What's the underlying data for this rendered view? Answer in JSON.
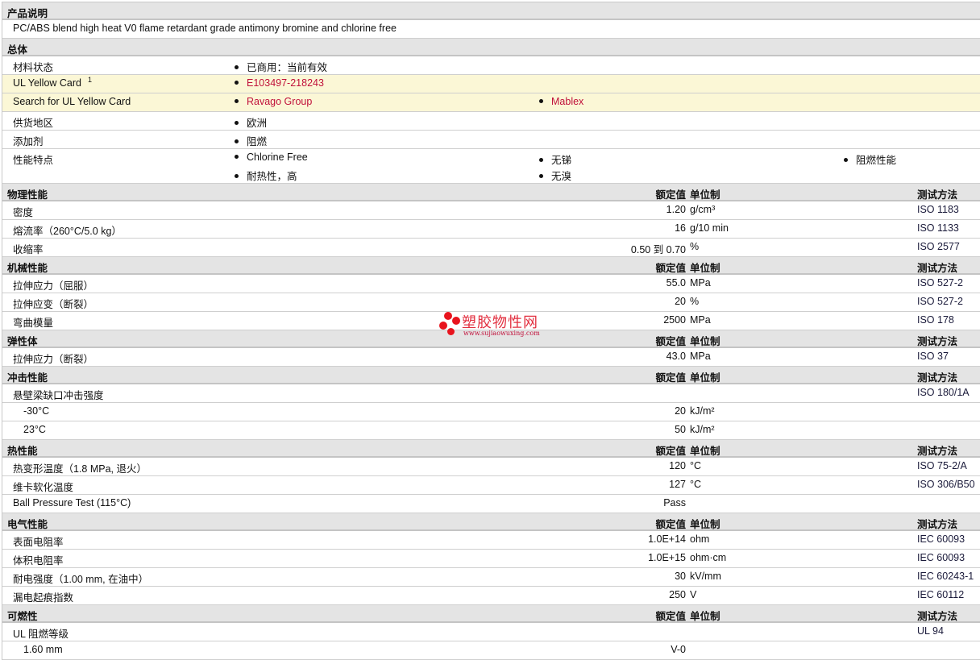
{
  "description_section": {
    "title": "产品说明",
    "text": "PC/ABS blend high heat V0 flame retardant grade antimony bromine and chlorine free"
  },
  "general_section": {
    "title": "总体",
    "rows": [
      {
        "label": "材料状态",
        "items": [
          [
            "已商用：当前有效"
          ]
        ]
      },
      {
        "label": "UL Yellow Card",
        "sup": "1",
        "yellow": true,
        "link": true,
        "items": [
          [
            "E103497-218243"
          ]
        ]
      },
      {
        "label": "Search for UL Yellow Card",
        "yellow": true,
        "link": true,
        "items": [
          [
            "Ravago Group"
          ],
          [
            "Mablex"
          ]
        ]
      },
      {
        "label": "供货地区",
        "items": [
          [
            "欧洲"
          ]
        ]
      },
      {
        "label": "添加剂",
        "items": [
          [
            "阻燃"
          ]
        ]
      },
      {
        "label": "性能特点",
        "items": [
          [
            "Chlorine Free",
            "耐热性，高"
          ],
          [
            "无锑",
            "无溴"
          ],
          [
            "阻燃性能"
          ]
        ]
      }
    ]
  },
  "column_headers": {
    "value": "额定值",
    "unit": "单位制",
    "method": "测试方法"
  },
  "property_sections": [
    {
      "title": "物理性能",
      "rows": [
        {
          "label": "密度",
          "value": "1.20",
          "unit": "g/cm³",
          "method": "ISO 1183"
        },
        {
          "label": "熔流率（260°C/5.0 kg）",
          "value": "16",
          "unit": "g/10 min",
          "method": "ISO 1133"
        },
        {
          "label": "收缩率",
          "value": "0.50 到  0.70",
          "unit": "%",
          "method": "ISO 2577"
        }
      ]
    },
    {
      "title": "机械性能",
      "rows": [
        {
          "label": "拉伸应力（屈服）",
          "value": "55.0",
          "unit": "MPa",
          "method": "ISO 527-2"
        },
        {
          "label": "拉伸应变（断裂）",
          "value": "20",
          "unit": "%",
          "method": "ISO 527-2"
        },
        {
          "label": "弯曲模量",
          "value": "2500",
          "unit": "MPa",
          "method": "ISO 178"
        }
      ]
    },
    {
      "title": "弹性体",
      "rows": [
        {
          "label": "拉伸应力（断裂）",
          "value": "43.0",
          "unit": "MPa",
          "method": "ISO 37"
        }
      ]
    },
    {
      "title": "冲击性能",
      "rows": [
        {
          "label": "悬壁梁缺口冲击强度",
          "value": "",
          "unit": "",
          "method": "ISO 180/1A"
        },
        {
          "label": "-30°C",
          "indent": true,
          "value": "20",
          "unit": "kJ/m²",
          "method": ""
        },
        {
          "label": "23°C",
          "indent": true,
          "value": "50",
          "unit": "kJ/m²",
          "method": ""
        }
      ]
    },
    {
      "title": "热性能",
      "rows": [
        {
          "label": "热变形温度（1.8 MPa, 退火）",
          "value": "120",
          "unit": "°C",
          "method": "ISO 75-2/A"
        },
        {
          "label": "维卡软化温度",
          "value": "127",
          "unit": "°C",
          "method": "ISO 306/B50"
        },
        {
          "label": "Ball Pressure Test (115°C)",
          "value": "Pass",
          "unit": "",
          "method": ""
        }
      ]
    },
    {
      "title": "电气性能",
      "rows": [
        {
          "label": "表面电阻率",
          "value": "1.0E+14",
          "unit": "ohm",
          "method": "IEC 60093"
        },
        {
          "label": "体积电阻率",
          "value": "1.0E+15",
          "unit": "ohm·cm",
          "method": "IEC 60093"
        },
        {
          "label": "耐电强度（1.00 mm, 在油中）",
          "value": "30",
          "unit": "kV/mm",
          "method": "IEC 60243-1"
        },
        {
          "label": "漏电起痕指数",
          "value": "250",
          "unit": "V",
          "method": "IEC 60112"
        }
      ]
    },
    {
      "title": "可燃性",
      "rows": [
        {
          "label": "UL 阻燃等级",
          "value": "",
          "unit": "",
          "method": "UL 94"
        },
        {
          "label": "1.60 mm",
          "indent": true,
          "value": "V-0",
          "unit": "",
          "method": ""
        }
      ]
    }
  ],
  "watermark": {
    "name": "塑胶物性网",
    "url": "www.sujiaowuxing.com"
  },
  "colors": {
    "link": "#c0103a",
    "header_bg": "#e4e4e4",
    "highlight_bg": "#fbf7d6"
  }
}
